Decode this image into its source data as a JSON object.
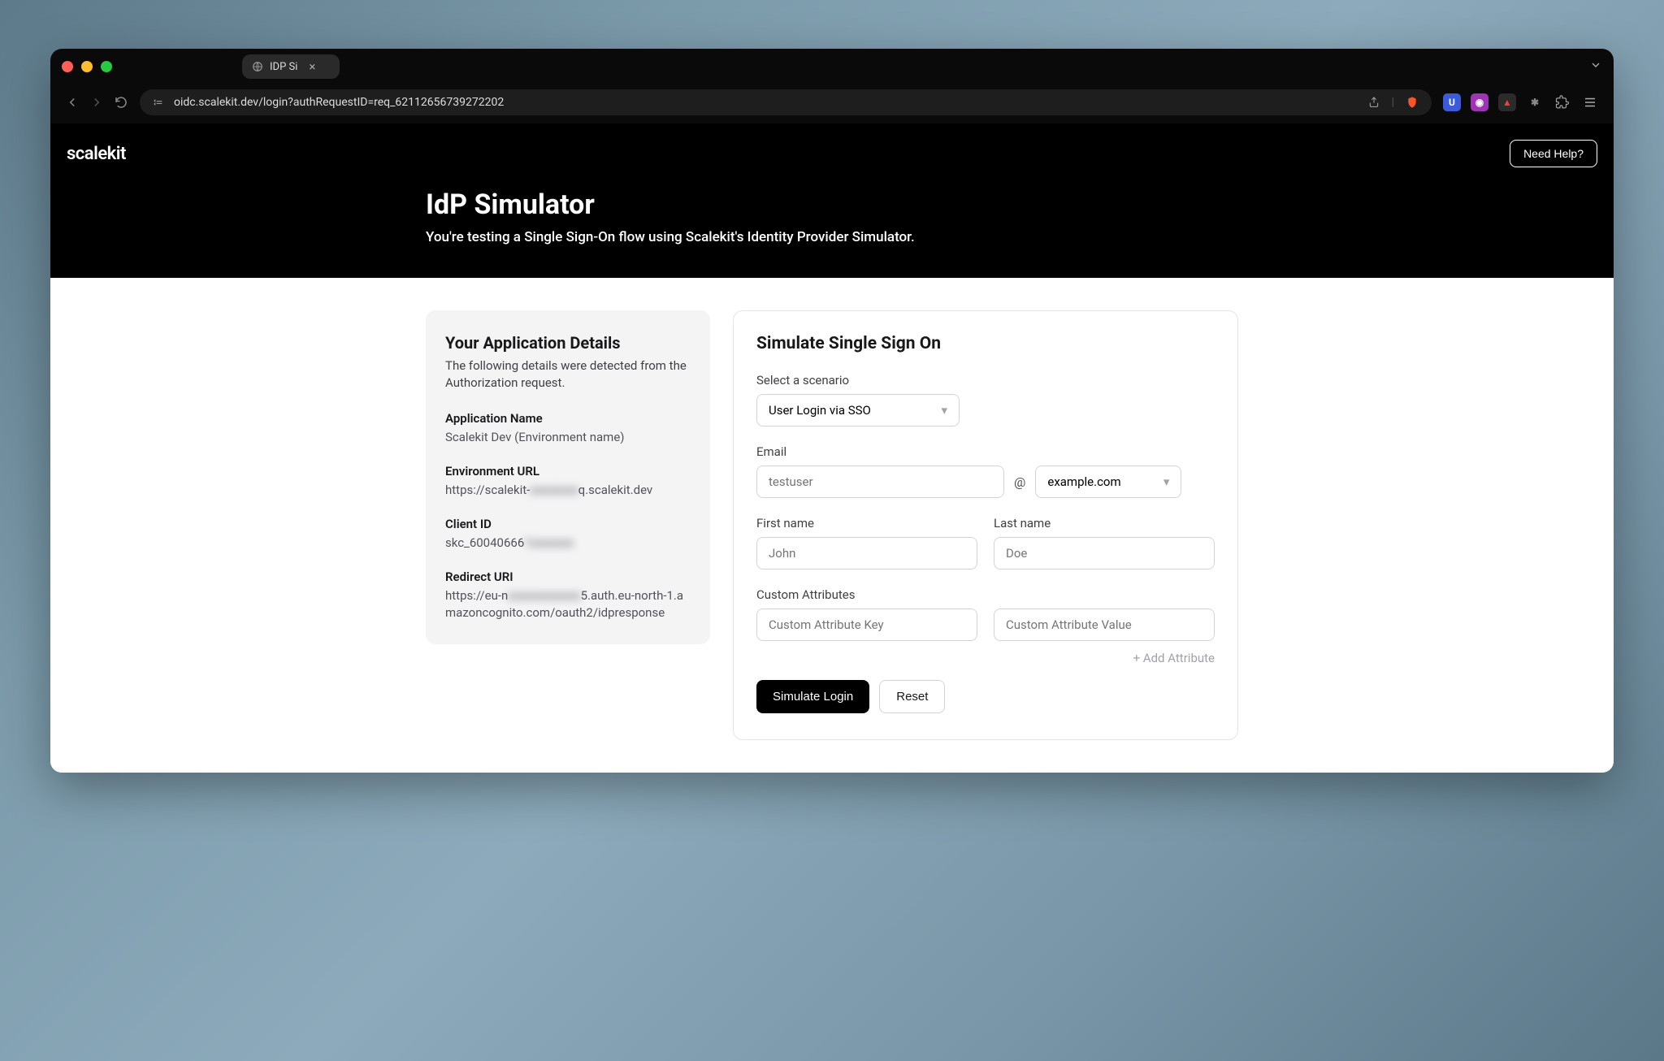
{
  "browser": {
    "tab_title": "IDP Si",
    "url": "oidc.scalekit.dev/login?authRequestID=req_62112656739272202"
  },
  "header": {
    "logo": "scalekit",
    "help_button": "Need Help?",
    "title": "IdP Simulator",
    "subtitle": "You're testing a Single Sign-On flow using Scalekit's Identity Provider Simulator."
  },
  "details": {
    "heading": "Your Application Details",
    "description": "The following details were detected from the Authorization request.",
    "app_name_label": "Application Name",
    "app_name_value": "Scalekit Dev (Environment name)",
    "env_url_label": "Environment URL",
    "env_url_prefix": "https://scalekit-",
    "env_url_blur": "xxxxxxxx",
    "env_url_suffix": "q.scalekit.dev",
    "client_id_label": "Client ID",
    "client_id_prefix": "skc_60040666",
    "client_id_blur": "1xxxxxxx",
    "redirect_label": "Redirect URI",
    "redirect_prefix": "https://eu-n",
    "redirect_blur": "xxxxxxxxxxxx",
    "redirect_suffix": "5.auth.eu-north-1.amazoncognito.com/oauth2/idpresponse"
  },
  "form": {
    "heading": "Simulate Single Sign On",
    "scenario_label": "Select a scenario",
    "scenario_value": "User Login via SSO",
    "email_label": "Email",
    "email_placeholder": "testuser",
    "at": "@",
    "domain_value": "example.com",
    "first_name_label": "First name",
    "first_name_placeholder": "John",
    "last_name_label": "Last name",
    "last_name_placeholder": "Doe",
    "custom_attr_label": "Custom Attributes",
    "custom_key_placeholder": "Custom Attribute Key",
    "custom_val_placeholder": "Custom Attribute Value",
    "add_attribute": "+ Add Attribute",
    "simulate_button": "Simulate Login",
    "reset_button": "Reset"
  }
}
